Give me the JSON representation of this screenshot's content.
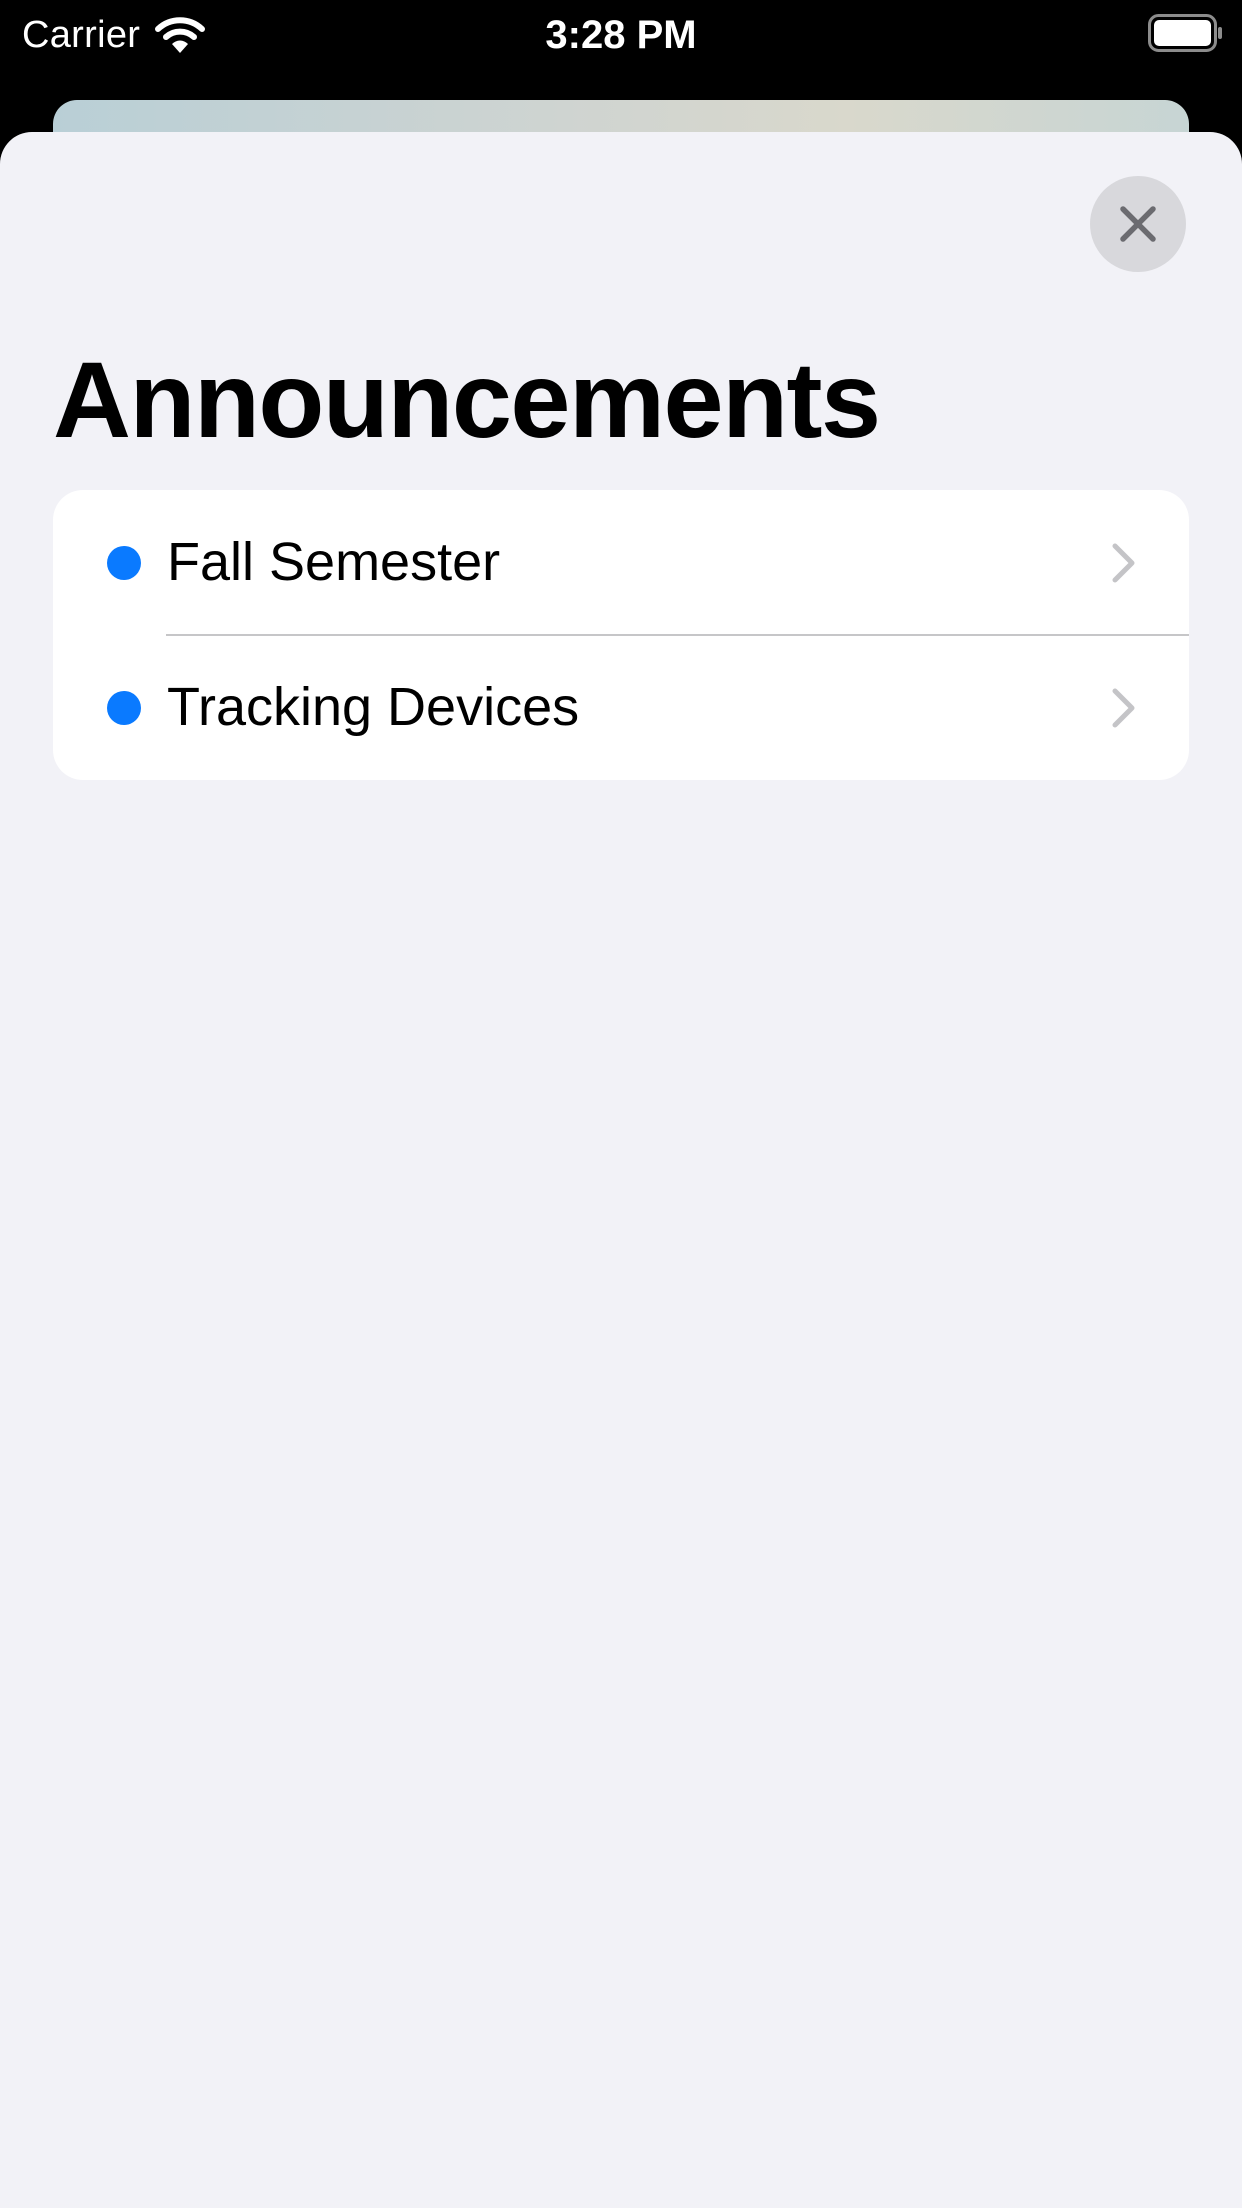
{
  "status_bar": {
    "carrier": "Carrier",
    "time": "3:28 PM",
    "wifi_icon": "wifi-icon",
    "battery_icon": "battery-icon"
  },
  "sheet": {
    "close_icon": "close-icon",
    "title": "Announcements"
  },
  "announcements": [
    {
      "title": "Fall Semester",
      "unread": true
    },
    {
      "title": "Tracking Devices",
      "unread": true
    }
  ],
  "colors": {
    "accent_dot": "#0a7aff",
    "sheet_background": "#f2f2f7",
    "chevron": "#c4c4c7",
    "separator": "#c6c6c8"
  }
}
